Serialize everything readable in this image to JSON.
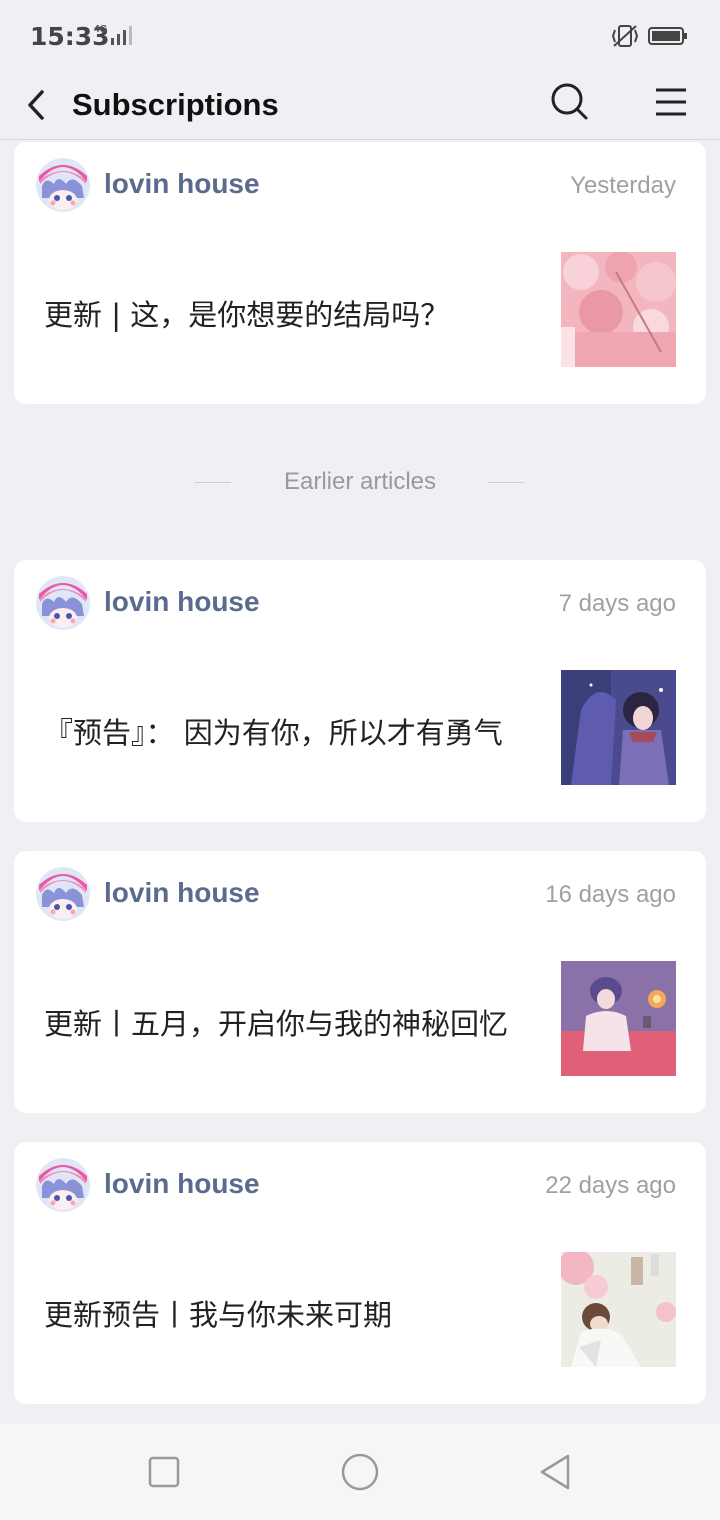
{
  "status_bar": {
    "time": "15:33",
    "network": "4G",
    "icons": [
      "signal-icon",
      "vibrate-icon",
      "battery-icon"
    ]
  },
  "header": {
    "title": "Subscriptions",
    "back_icon": "back-arrow-icon",
    "search_icon": "search-icon",
    "menu_icon": "menu-icon"
  },
  "latest": {
    "author": "lovin house",
    "time": "Yesterday",
    "headline": "更新 | 这，是你想要的结局吗？"
  },
  "divider_label": "Earlier articles",
  "articles": [
    {
      "author": "lovin house",
      "time": "7 days ago",
      "headline": "『预告』： 因为有你，所以才有勇气"
    },
    {
      "author": "lovin house",
      "time": "16 days ago",
      "headline": "更新丨五月，开启你与我的神秘回忆"
    },
    {
      "author": "lovin house",
      "time": "22 days ago",
      "headline": "更新预告丨我与你未来可期"
    }
  ],
  "nav": {
    "icons": [
      "recents-square-icon",
      "home-circle-icon",
      "back-triangle-icon"
    ]
  },
  "colors": {
    "author": "#5a6b8e",
    "background": "#efeff4",
    "card": "#ffffff"
  }
}
